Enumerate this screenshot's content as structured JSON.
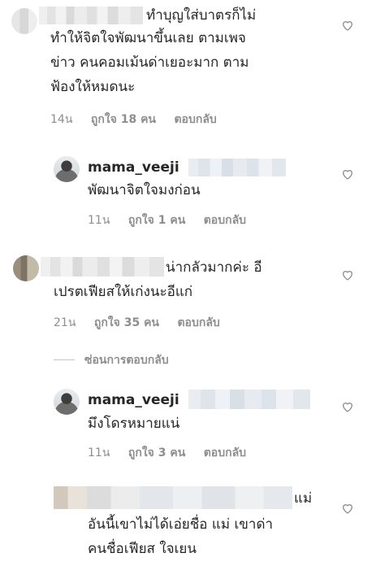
{
  "comments": [
    {
      "line1": "ทำบุญใส่บาตรก็ไม่",
      "line2": "ทำให้จิตใจพัฒนาขึ้นเลย ตามเพจ",
      "line3": "ข่าว คนคอมเม้นด่าเยอะมาก ตาม",
      "line4": "ฟ้องให้หมดนะ",
      "time": "14น",
      "likes": "ถูกใจ 18 คน",
      "reply": "ตอบกลับ"
    },
    {
      "username": "mama_veeji",
      "line1": "พัฒนาจิตใจมงก่อน",
      "time": "11น",
      "likes": "ถูกใจ 1 คน",
      "reply": "ตอบกลับ"
    },
    {
      "line1": "น่ากลัวมากค่ะ อี",
      "line2": "เปรตเฟียสให้เก่งนะอีแก่",
      "time": "21น",
      "likes": "ถูกใจ 35 คน",
      "reply": "ตอบกลับ"
    },
    {
      "username": "mama_veeji",
      "line1": "มึงโดรหมายแน่",
      "time": "11น",
      "likes": "ถูกใจ 3 คน",
      "reply": "ตอบกลับ"
    },
    {
      "line1": "แม่",
      "line2": "อันนี้เขาไม่ได้เอ่ยชื่อ แม่ เขาด่า",
      "line3": "คนชื่อเฟียส ใจเยน"
    }
  ],
  "hide_replies_label": "ซ่อนการตอบกลับ",
  "colors": {
    "text": "#262626",
    "meta": "#8e8e8e",
    "heart_stroke": "#8e8e8e"
  },
  "icons": {
    "heart": "heart-outline-icon"
  }
}
